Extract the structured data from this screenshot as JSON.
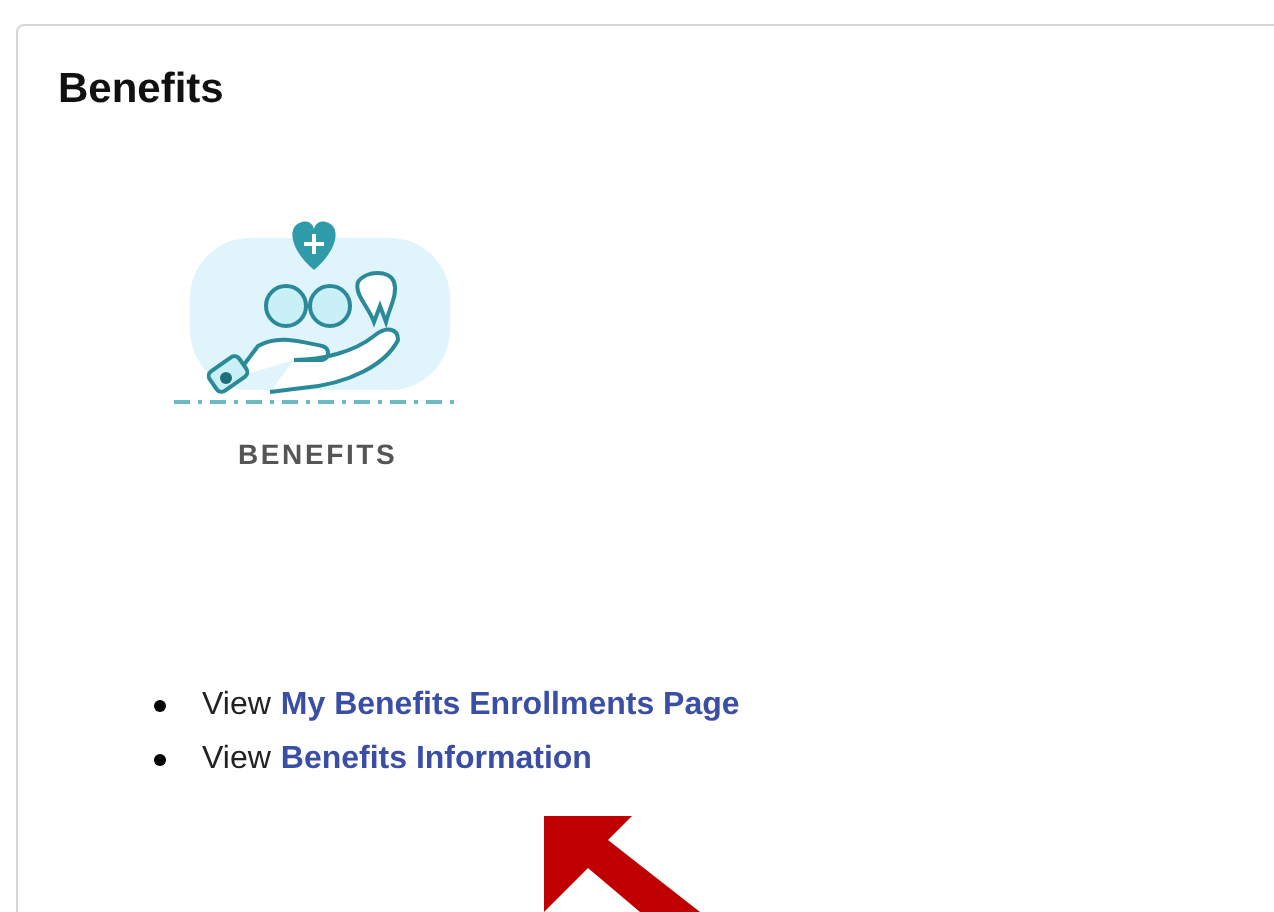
{
  "card": {
    "title": "Benefits"
  },
  "tile": {
    "label": "BENEFITS"
  },
  "links": [
    {
      "prefix": "View",
      "link": "My Benefits Enrollments Page"
    },
    {
      "prefix": "View",
      "link": "Benefits Information"
    }
  ]
}
